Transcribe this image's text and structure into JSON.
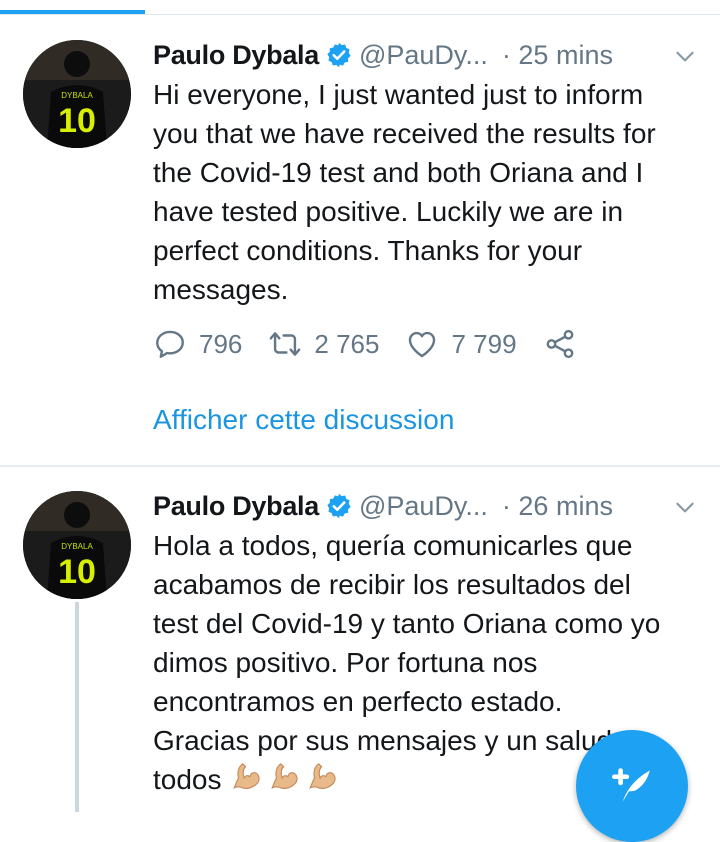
{
  "colors": {
    "accent": "#1da1f2",
    "link": "#1b95e0",
    "muted": "#657786",
    "text": "#14171a"
  },
  "tweets": [
    {
      "name": "Paulo Dybala",
      "handle": "@PauDy...",
      "time": "· 25 mins",
      "text": "Hi everyone, I just wanted just  to inform\nyou that we have received the results for\nthe Covid-19 test and both Oriana and I\nhave tested positive. Luckily we are in\nperfect conditions. Thanks for your\nmessages.",
      "replies": "796",
      "retweets": "2 765",
      "likes": "7 799",
      "show_thread": "Afficher cette discussion"
    },
    {
      "name": "Paulo Dybala",
      "handle": "@PauDy...",
      "time": "· 26 mins",
      "text": "Hola a todos, quería comunicarles que\nacabamos de recibir los resultados del\ntest del Covid-19 y tanto Oriana como yo\ndimos positivo. Por fortuna nos\nencontramos en perfecto estado.\nGracias por sus mensajes y un saludo a\ntodos",
      "emoji": "💪💪💪"
    }
  ],
  "avatar": {
    "jersey_text": "DYBALA",
    "jersey_number": "10"
  },
  "icons": {
    "verified": "verified-badge-icon",
    "caret": "chevron-down-icon",
    "reply": "reply-icon",
    "retweet": "retweet-icon",
    "like": "heart-icon",
    "share": "share-icon",
    "compose": "compose-tweet-icon"
  }
}
